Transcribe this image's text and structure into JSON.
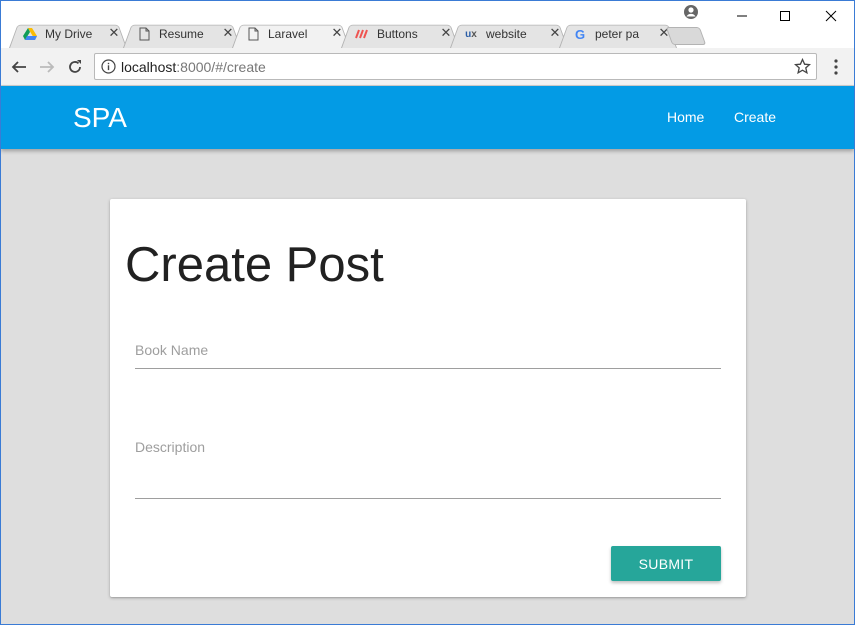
{
  "browser": {
    "tabs": [
      {
        "title": "My Drive",
        "icon": "google-drive-icon",
        "active": false
      },
      {
        "title": "Resume",
        "icon": "document-icon",
        "active": false
      },
      {
        "title": "Laravel",
        "icon": "document-icon",
        "active": true
      },
      {
        "title": "Buttons",
        "icon": "buttons-site-icon",
        "active": false
      },
      {
        "title": "website",
        "icon": "ux-icon",
        "active": false
      },
      {
        "title": "peter pa",
        "icon": "google-icon",
        "active": false
      }
    ],
    "url_host": "localhost",
    "url_path": ":8000/#/create"
  },
  "app": {
    "brand": "SPA",
    "nav": [
      "Home",
      "Create"
    ],
    "accent_color": "#039be5"
  },
  "form": {
    "title": "Create Post",
    "book_name_label": "Book Name",
    "description_label": "Description",
    "submit_label": "SUBMIT",
    "submit_color": "#26a69a"
  }
}
